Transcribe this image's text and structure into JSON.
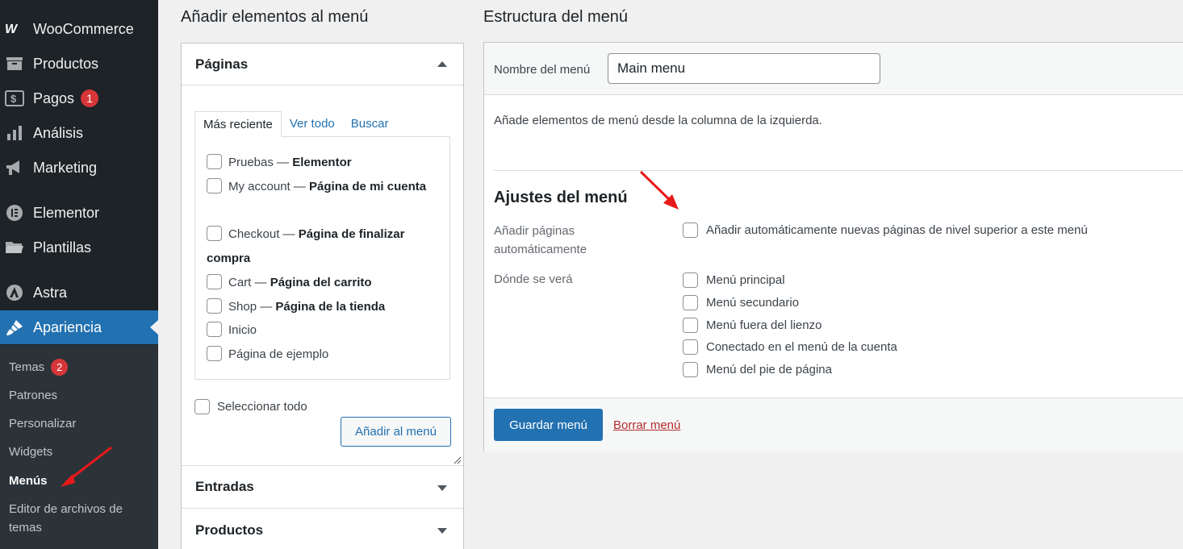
{
  "sidebar": {
    "items": [
      {
        "label": "WooCommerce",
        "icon": "woo-icon"
      },
      {
        "label": "Productos",
        "icon": "archive-icon"
      },
      {
        "label": "Pagos",
        "icon": "money-icon",
        "badge": "1"
      },
      {
        "label": "Análisis",
        "icon": "bar-chart-icon"
      },
      {
        "label": "Marketing",
        "icon": "megaphone-icon"
      },
      {
        "label": "Elementor",
        "icon": "elementor-icon"
      },
      {
        "label": "Plantillas",
        "icon": "folder-icon"
      },
      {
        "label": "Astra",
        "icon": "astra-icon"
      },
      {
        "label": "Apariencia",
        "icon": "paintbrush-icon",
        "active": true
      }
    ],
    "submenu": [
      {
        "label": "Temas",
        "badge": "2"
      },
      {
        "label": "Patrones"
      },
      {
        "label": "Personalizar"
      },
      {
        "label": "Widgets"
      },
      {
        "label": "Menús",
        "current": true
      },
      {
        "label": "Editor de archivos de temas"
      }
    ]
  },
  "left": {
    "heading": "Añadir elementos al menú",
    "pages_section": {
      "title": "Páginas",
      "tabs": [
        "Más reciente",
        "Ver todo",
        "Buscar"
      ],
      "items": [
        {
          "name": "Pruebas",
          "sep": " — ",
          "tag": "Elementor"
        },
        {
          "name": "My account",
          "sep": " — ",
          "tag": "Página de mi cuenta"
        },
        {
          "name": "Checkout",
          "sep": " — ",
          "tag": "Página de finalizar compra"
        },
        {
          "name": "Cart",
          "sep": " — ",
          "tag": "Página del carrito"
        },
        {
          "name": "Shop",
          "sep": " — ",
          "tag": "Página de la tienda"
        },
        {
          "name": "Inicio",
          "sep": "",
          "tag": ""
        },
        {
          "name": "Página de ejemplo",
          "sep": "",
          "tag": ""
        }
      ],
      "select_all": "Seleccionar todo",
      "add_button": "Añadir al menú"
    },
    "entradas": "Entradas",
    "productos": "Productos"
  },
  "right": {
    "heading": "Estructura del menú",
    "menu_name_label": "Nombre del menú",
    "menu_name_value": "Main menu",
    "instructions": "Añade elementos de menú desde la columna de la izquierda.",
    "settings_title": "Ajustes del menú",
    "auto_add_label": "Añadir páginas automáticamente",
    "auto_add_option": "Añadir automáticamente nuevas páginas de nivel superior a este menú",
    "locations_label": "Dónde se verá",
    "locations": [
      "Menú principal",
      "Menú secundario",
      "Menú fuera del lienzo",
      "Conectado en el menú de la cuenta",
      "Menú del pie de página"
    ],
    "save_button": "Guardar menú",
    "delete_link": "Borrar menú"
  },
  "colors": {
    "accent": "#2271b1",
    "sidebar_bg": "#1d2327",
    "badge": "#d63638",
    "annotation_arrow": "#e8191a"
  }
}
